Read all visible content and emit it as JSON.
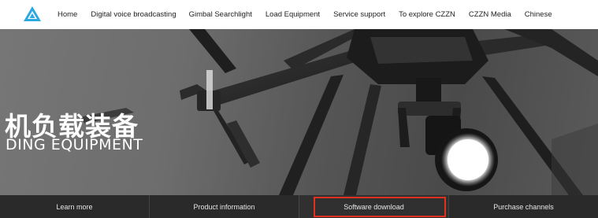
{
  "nav": {
    "logo_icon": "czzn-triangle-logo-icon",
    "brand_color": "#2aa8e0",
    "items": [
      {
        "label": "Home"
      },
      {
        "label": "Digital voice broadcasting"
      },
      {
        "label": "Gimbal Searchlight"
      },
      {
        "label": "Load Equipment"
      },
      {
        "label": "Service support"
      },
      {
        "label": "To explore CZZN"
      },
      {
        "label": "CZZN Media"
      },
      {
        "label": "Chinese"
      }
    ]
  },
  "hero": {
    "title_cn": "机负载装备",
    "title_en": "DING EQUIPMENT"
  },
  "tabs": {
    "items": [
      {
        "label": "Learn more"
      },
      {
        "label": "Product information"
      },
      {
        "label": "Software download"
      },
      {
        "label": "Purchase channels"
      }
    ],
    "highlight_color": "#e0311f"
  }
}
